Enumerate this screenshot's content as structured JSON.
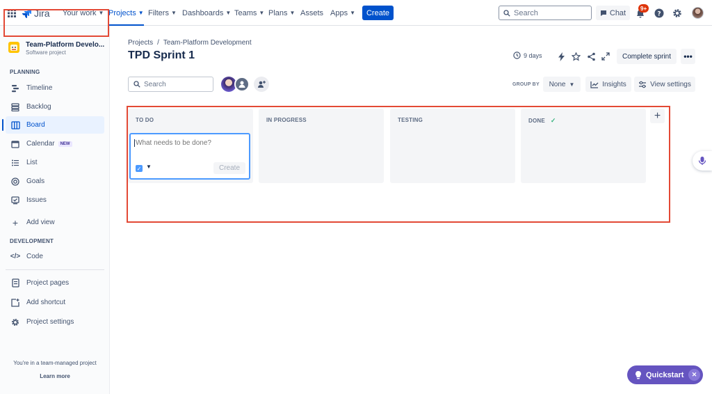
{
  "topnav": {
    "logo_text": "Jira",
    "items": [
      {
        "label": "Your work"
      },
      {
        "label": "Projects"
      },
      {
        "label": "Filters"
      },
      {
        "label": "Dashboards"
      },
      {
        "label": "Teams"
      },
      {
        "label": "Plans"
      },
      {
        "label": "Assets"
      },
      {
        "label": "Apps"
      }
    ],
    "create_label": "Create",
    "search_placeholder": "Search",
    "chat_label": "Chat",
    "notifications_badge": "9+",
    "accent": "#0052cc"
  },
  "sidebar": {
    "project_name": "Team-Platform Develo...",
    "project_type": "Software project",
    "planning_heading": "PLANNING",
    "planning_items": [
      {
        "label": "Timeline",
        "icon": "timeline-icon"
      },
      {
        "label": "Backlog",
        "icon": "backlog-icon"
      },
      {
        "label": "Board",
        "icon": "board-icon"
      },
      {
        "label": "Calendar",
        "icon": "calendar-icon",
        "badge": "NEW"
      },
      {
        "label": "List",
        "icon": "list-icon"
      },
      {
        "label": "Goals",
        "icon": "goals-icon"
      },
      {
        "label": "Issues",
        "icon": "issues-icon"
      }
    ],
    "add_view_label": "Add view",
    "development_heading": "DEVELOPMENT",
    "code_label": "Code",
    "project_pages_label": "Project pages",
    "add_shortcut_label": "Add shortcut",
    "project_settings_label": "Project settings",
    "footer_text": "You're in a team-managed project",
    "learn_more_label": "Learn more"
  },
  "main": {
    "breadcrumb": [
      "Projects",
      "Team-Platform Development"
    ],
    "title": "TPD Sprint 1",
    "sprint_days": "9 days",
    "complete_sprint_label": "Complete sprint",
    "board_search_placeholder": "Search",
    "group_by_label": "GROUP BY",
    "group_by_value": "None",
    "insights_label": "Insights",
    "view_settings_label": "View settings"
  },
  "board": {
    "columns": [
      {
        "title": "TO DO"
      },
      {
        "title": "IN PROGRESS"
      },
      {
        "title": "TESTING"
      },
      {
        "title": "DONE"
      }
    ],
    "create_card": {
      "placeholder": "What needs to be done?",
      "button_label": "Create"
    }
  },
  "quickstart": {
    "label": "Quickstart"
  }
}
